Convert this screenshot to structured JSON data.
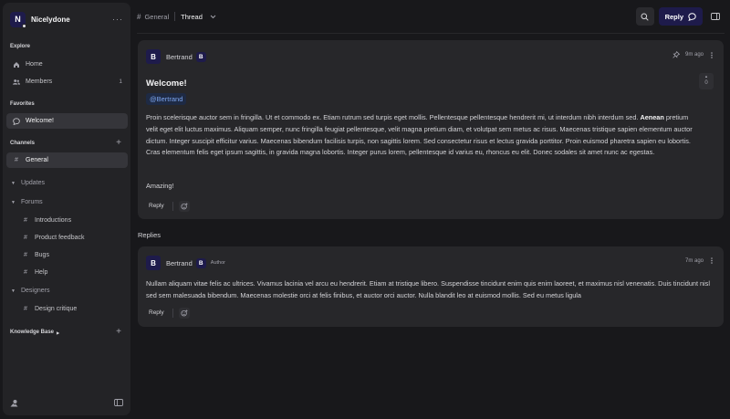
{
  "workspace": {
    "initial": "N",
    "name": "Nicelydone",
    "more": "···"
  },
  "sidebar": {
    "explore_title": "Explore",
    "home": "Home",
    "members": "Members",
    "members_count": "1",
    "favorites_title": "Favorites",
    "welcome": "Welcome!",
    "channels_title": "Channels",
    "general": "General",
    "updates": "Updates",
    "forums": "Forums",
    "forum_items": [
      "Introductions",
      "Product feedback",
      "Bugs",
      "Help"
    ],
    "designers": "Designers",
    "designer_items": [
      "Design critique"
    ],
    "knowledge_base": "Knowledge Base"
  },
  "header": {
    "channel": "General",
    "thread": "Thread",
    "reply_label": "Reply"
  },
  "post": {
    "author_initial": "B",
    "author": "Bertrand",
    "badge_initial": "B",
    "time": "9m ago",
    "votes": "0",
    "title": "Welcome!",
    "mention": "@Bertrand",
    "body_lead": "Proin scelerisque auctor sem in fringilla. Ut et commodo ex. Etiam rutrum sed turpis eget mollis. Pellentesque pellentesque hendrerit mi, ut interdum nibh interdum sed.",
    "body_bold": "Aenean",
    "body_rest": "pretium velit eget elit luctus maximus. Aliquam semper, nunc fringilla feugiat pellentesque, velit magna pretium diam, et volutpat sem metus ac risus. Maecenas tristique sapien elementum auctor dictum. Integer suscipit efficitur varius. Maecenas bibendum facilisis turpis, non sagittis lorem. Sed consectetur risus et lectus gravida porttitor. Proin euismod pharetra sapien eu lobortis. Cras elementum felis eget ipsum sagittis, in gravida magna lobortis. Integer purus lorem, pellentesque id varius eu, rhoncus eu elit. Donec sodales sit amet nunc ac egestas.",
    "closing": "Amazing!",
    "reply_action": "Reply"
  },
  "replies": {
    "label": "Replies",
    "items": [
      {
        "author_initial": "B",
        "author": "Bertrand",
        "badge_initial": "B",
        "tag": "Author",
        "time": "7m ago",
        "body": "Nullam aliquam vitae felis ac ultrices. Vivamus lacinia vel arcu eu hendrerit. Etiam at tristique libero. Suspendisse tincidunt enim quis enim laoreet, et maximus nisl venenatis. Duis tincidunt nisl sed sem malesuada bibendum. Maecenas molestie orci at felis finibus, et auctor orci auctor. Nulla blandit leo at euismod mollis. Sed eu metus ligula",
        "reply_action": "Reply"
      }
    ]
  },
  "colors": {
    "background": "#18181b",
    "panel": "#232326",
    "card": "#27272a",
    "accent": "#1e1b4b",
    "mention": "#7da6f0"
  },
  "icons": [
    "home-icon",
    "members-icon",
    "chat-icon",
    "hash-icon",
    "search-icon",
    "reply-bubble-icon",
    "layout-icon",
    "pin-icon",
    "kebab-icon",
    "emoji-add-icon",
    "theme-icon",
    "sidebar-toggle-icon"
  ]
}
